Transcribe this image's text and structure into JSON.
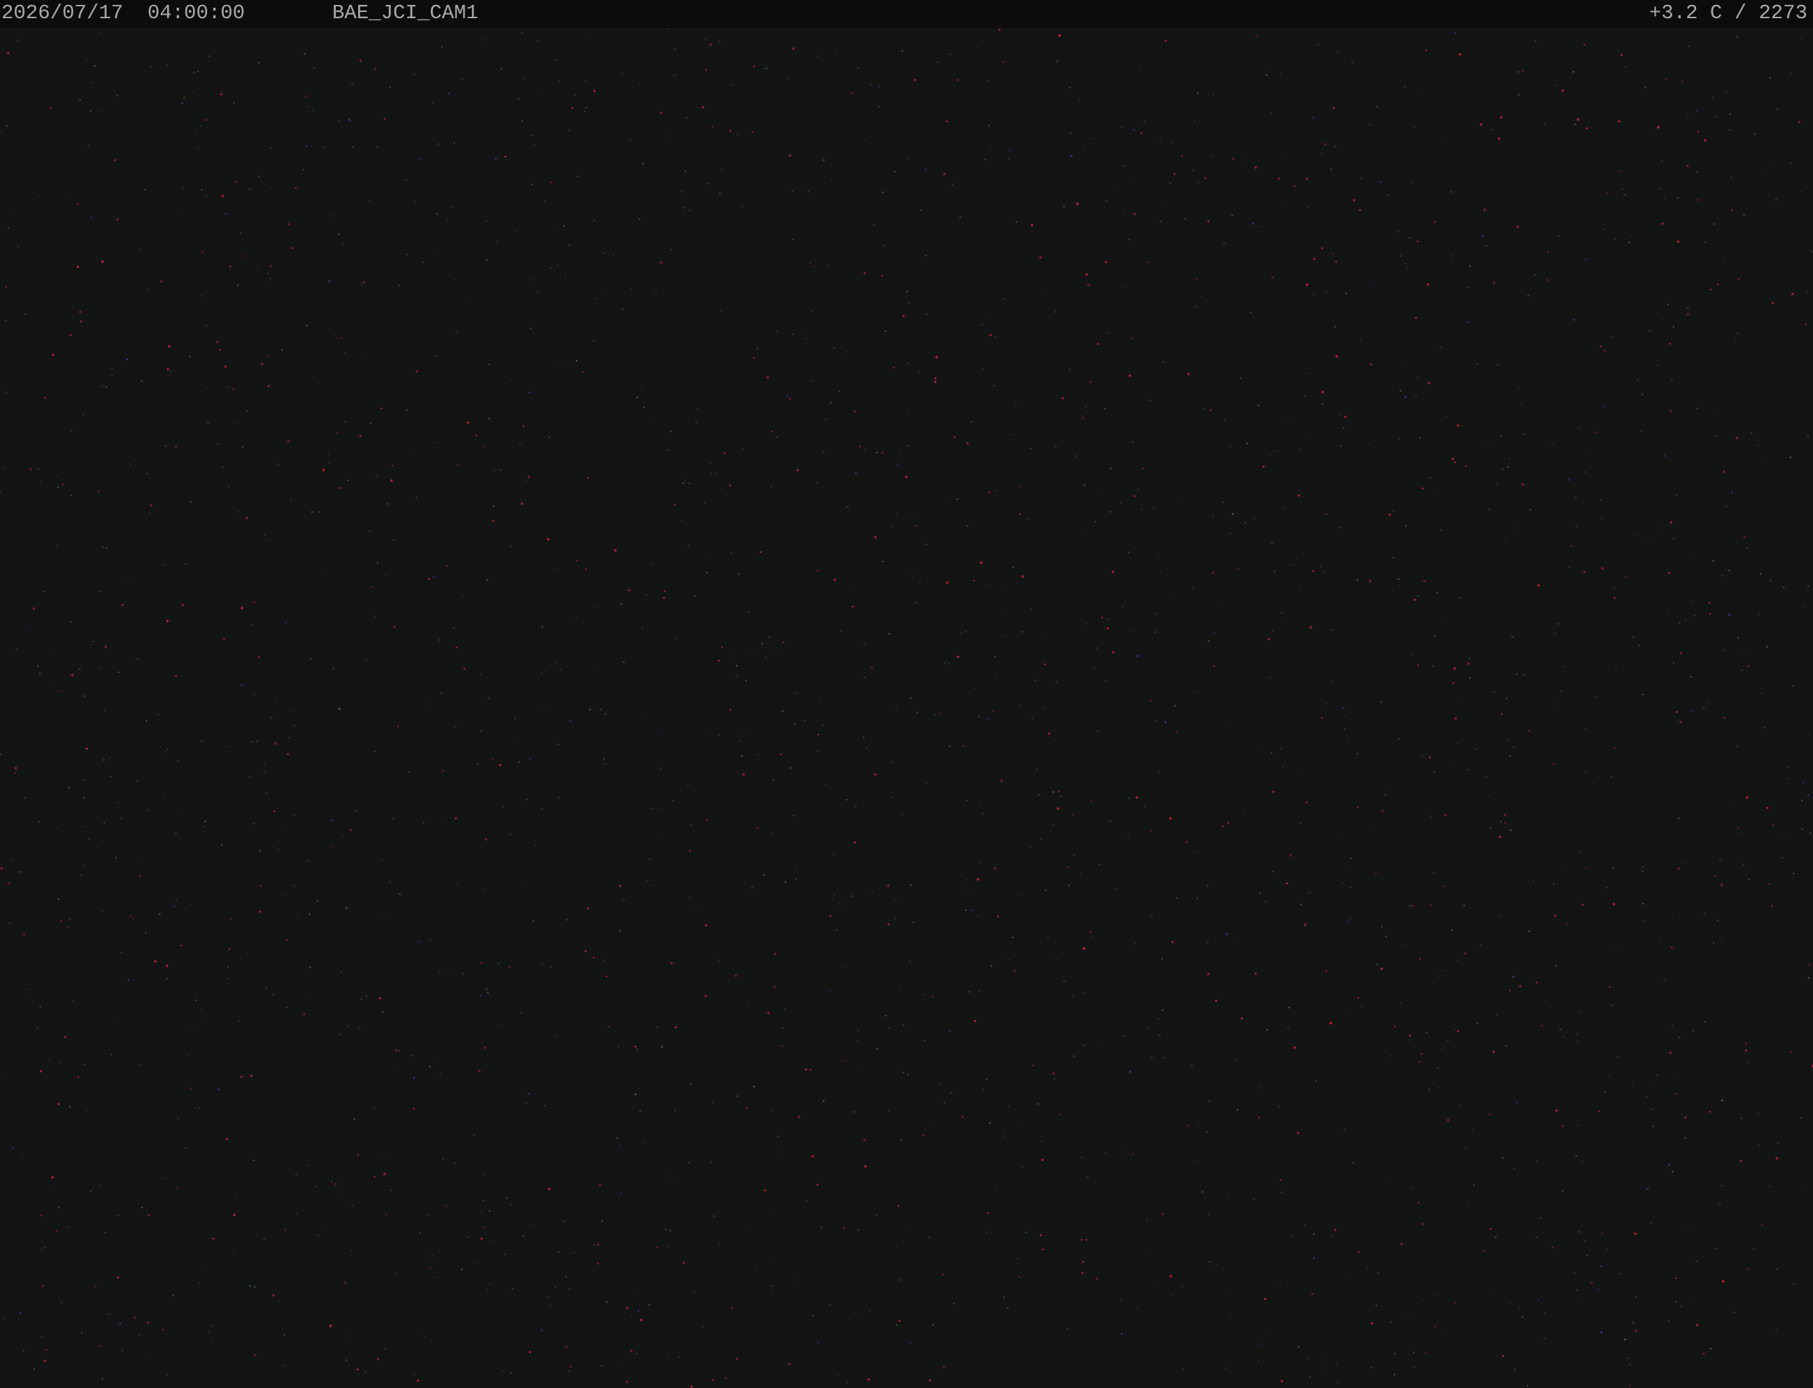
{
  "overlay": {
    "datetime": "2026/07/17  04:00:00",
    "camera_name": "BAE_JCI_CAM1",
    "readout": "+3.2 C / 2273"
  },
  "colors": {
    "background": "#131414",
    "header_bar": "#0c0c0c",
    "overlay_text": "#a9a9a9",
    "noise_red": "#b8203a",
    "noise_green": "#4a6e52",
    "noise_blue": "#3a3fa0"
  }
}
